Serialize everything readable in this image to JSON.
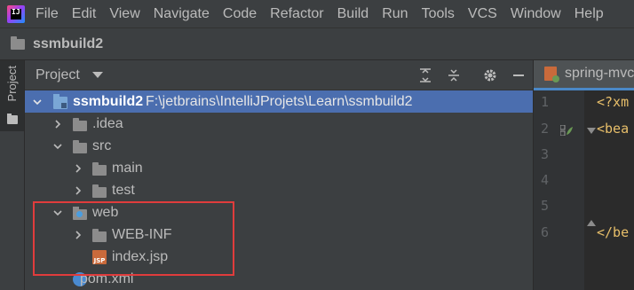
{
  "menu": {
    "logo_label": "IJ",
    "items": [
      "File",
      "Edit",
      "View",
      "Navigate",
      "Code",
      "Refactor",
      "Build",
      "Run",
      "Tools",
      "VCS",
      "Window",
      "Help"
    ]
  },
  "titlebar": {
    "project_name": "ssmbuild2"
  },
  "toolstrip": {
    "project_tab_label": "Project"
  },
  "panel": {
    "title": "Project",
    "header_icons": [
      "expand-all-icon",
      "collapse-all-icon",
      "gear-icon",
      "minimize-icon"
    ],
    "tree": [
      {
        "label": "ssmbuild2",
        "path": "F:\\jetbrains\\IntelliJProjets\\Learn\\ssmbuild2",
        "icon": "module-folder-icon",
        "expanded": true,
        "selected": true
      },
      {
        "label": ".idea",
        "icon": "folder-icon",
        "expanded": false
      },
      {
        "label": "src",
        "icon": "folder-icon",
        "expanded": true
      },
      {
        "label": "main",
        "icon": "folder-icon",
        "expanded": false
      },
      {
        "label": "test",
        "icon": "folder-icon",
        "expanded": false
      },
      {
        "label": "web",
        "icon": "web-folder-icon",
        "expanded": true
      },
      {
        "label": "WEB-INF",
        "icon": "folder-icon",
        "expanded": false
      },
      {
        "label": "index.jsp",
        "icon": "jsp-file-icon",
        "icon_text": "JSP"
      },
      {
        "label": "pom.xml",
        "icon": "xml-file-icon"
      }
    ]
  },
  "editor": {
    "tab_label": "spring-mvc",
    "line_numbers": [
      "1",
      "2",
      "3",
      "4",
      "5",
      "6"
    ],
    "code_lines": [
      "<?xm",
      "<bea",
      "",
      "",
      "",
      "</be"
    ]
  },
  "colors": {
    "selection": "#4b6eaf",
    "highlight_box": "#e03c3c",
    "accent": "#4a88c7"
  }
}
